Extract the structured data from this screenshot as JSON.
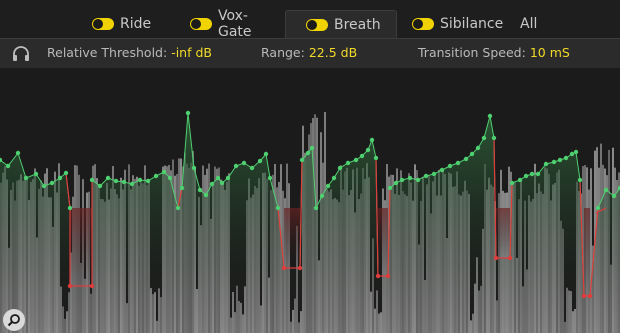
{
  "tabs": [
    {
      "label": "Ride",
      "enabled": true,
      "active": false
    },
    {
      "label": "Vox-Gate",
      "enabled": true,
      "active": false
    },
    {
      "label": "Breath",
      "enabled": true,
      "active": true
    },
    {
      "label": "Sibilance",
      "enabled": true,
      "active": false
    },
    {
      "label": "All",
      "active": false
    }
  ],
  "params": {
    "monitor_icon": "headphones-icon",
    "threshold_label": "Relative Threshold:",
    "threshold_value": "-inf dB",
    "range_label": "Range:",
    "range_value": "22.5 dB",
    "transition_label": "Transition Speed:",
    "transition_value": "10 mS"
  },
  "colors": {
    "accent": "#f2da2b",
    "waveform": "#8c8c8c",
    "green_curve": "#4fd070",
    "red_curve": "#e03c3c"
  },
  "zoom_icon": "magnifier-icon"
}
